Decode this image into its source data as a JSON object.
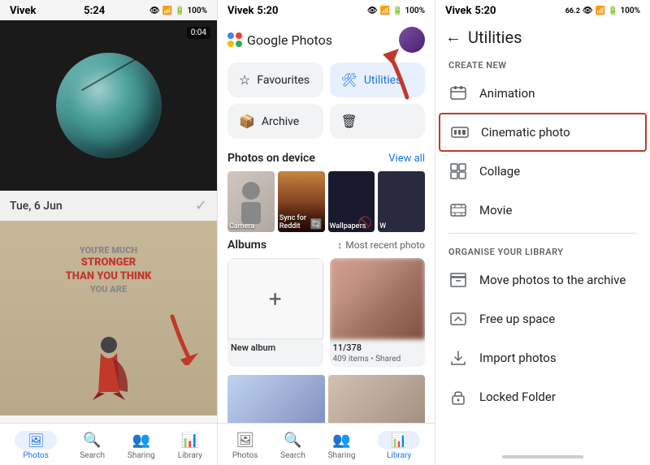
{
  "panel1": {
    "status": {
      "name": "Vivek",
      "time": "5:24",
      "battery": "100%"
    },
    "video_duration": "0:04",
    "date_label": "Tue, 6 Jun",
    "superman_lines": [
      "YOU'RE MUCH",
      "STRONGER",
      "THAN YOU THINK",
      "YOU ARE"
    ],
    "nav_items": [
      {
        "label": "Photos",
        "active": true
      },
      {
        "label": "Search",
        "active": false
      },
      {
        "label": "Sharing",
        "active": false
      },
      {
        "label": "Library",
        "active": false
      }
    ]
  },
  "panel2": {
    "status": {
      "name": "Vivek",
      "time": "5:20",
      "battery": "100%"
    },
    "app_title": "Google Photos",
    "buttons": [
      {
        "label": "Favourites",
        "icon": "☆"
      },
      {
        "label": "Utilities",
        "icon": "🛠",
        "highlighted": true
      },
      {
        "label": "Archive",
        "icon": "🗄"
      },
      {
        "label": "🗑",
        "icon": "🗑",
        "highlighted": false
      }
    ],
    "photos_section": {
      "title": "Photos on device",
      "view_all": "View all",
      "photos": [
        {
          "label": "Camera"
        },
        {
          "label": "Sync for Reddit"
        },
        {
          "label": "Wallpapers"
        },
        {
          "label": "W"
        }
      ]
    },
    "albums_section": {
      "title": "Albums",
      "sort_label": "Most recent photo",
      "albums": [
        {
          "label": "New album",
          "is_new": true
        },
        {
          "label": "11/378",
          "sublabel": "409 items • Shared"
        }
      ]
    },
    "nav_items": [
      {
        "label": "Photos",
        "active": false
      },
      {
        "label": "Search",
        "active": false
      },
      {
        "label": "Sharing",
        "active": false
      },
      {
        "label": "Library",
        "active": true
      }
    ]
  },
  "panel3": {
    "status": {
      "name": "Vivek",
      "time": "5:20",
      "battery": "100%"
    },
    "title": "Utilities",
    "create_new_label": "CREATE NEW",
    "create_items": [
      {
        "label": "Animation"
      },
      {
        "label": "Cinematic photo",
        "highlighted": true
      },
      {
        "label": "Collage"
      },
      {
        "label": "Movie"
      }
    ],
    "organise_label": "ORGANISE YOUR LIBRARY",
    "organise_items": [
      {
        "label": "Move photos to the archive"
      },
      {
        "label": "Free up space"
      },
      {
        "label": "Import photos"
      },
      {
        "label": "Locked Folder"
      }
    ]
  }
}
